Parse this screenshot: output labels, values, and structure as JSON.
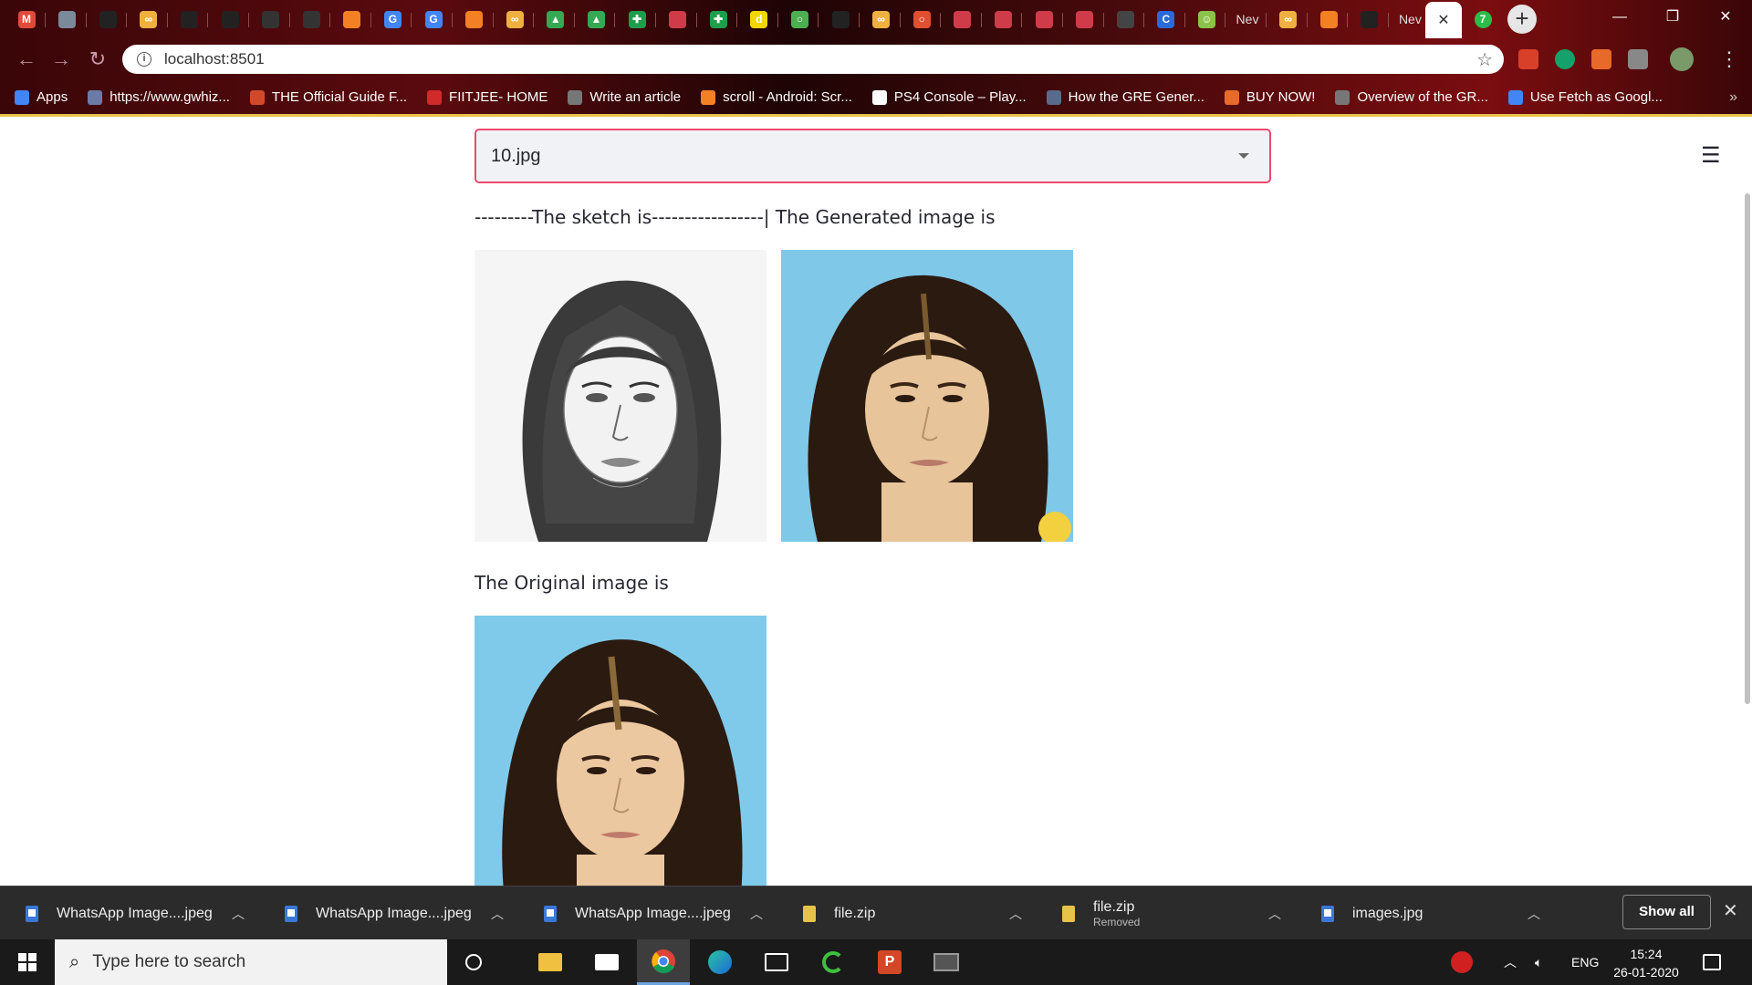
{
  "browser": {
    "tabs": [
      {
        "icon": "gmail-icon",
        "color": "#e04a3a",
        "glyph": "M"
      },
      {
        "icon": "globe-icon",
        "color": "#7a8a9a",
        "glyph": ""
      },
      {
        "icon": "github-icon",
        "color": "#222",
        "glyph": ""
      },
      {
        "icon": "codechef-icon",
        "color": "#f0b040",
        "glyph": "∞"
      },
      {
        "icon": "github-icon",
        "color": "#222",
        "glyph": ""
      },
      {
        "icon": "github-icon",
        "color": "#222",
        "glyph": ""
      },
      {
        "icon": "box-icon",
        "color": "#333",
        "glyph": ""
      },
      {
        "icon": "box-icon",
        "color": "#333",
        "glyph": ""
      },
      {
        "icon": "stackoverflow-icon",
        "color": "#f48024",
        "glyph": ""
      },
      {
        "icon": "google-icon",
        "color": "#4285f4",
        "glyph": "G"
      },
      {
        "icon": "google-icon",
        "color": "#4285f4",
        "glyph": "G"
      },
      {
        "icon": "stackoverflow-icon",
        "color": "#f48024",
        "glyph": ""
      },
      {
        "icon": "codechef-icon",
        "color": "#f0b040",
        "glyph": "∞"
      },
      {
        "icon": "drive-icon",
        "color": "#34a853",
        "glyph": "▲"
      },
      {
        "icon": "drive-icon",
        "color": "#34a853",
        "glyph": "▲"
      },
      {
        "icon": "plus-green-icon",
        "color": "#1e9e4a",
        "glyph": "✚"
      },
      {
        "icon": "mail-red-icon",
        "color": "#d03b4a",
        "glyph": ""
      },
      {
        "icon": "plus-green-icon",
        "color": "#1e9e4a",
        "glyph": "✚"
      },
      {
        "icon": "d-icon",
        "color": "#f2d600",
        "glyph": "d"
      },
      {
        "icon": "circle-green-icon",
        "color": "#4caf50",
        "glyph": "○"
      },
      {
        "icon": "github-icon",
        "color": "#222",
        "glyph": ""
      },
      {
        "icon": "codechef-icon",
        "color": "#f0b040",
        "glyph": "∞"
      },
      {
        "icon": "circle-red-icon",
        "color": "#e05030",
        "glyph": "○"
      },
      {
        "icon": "mail-red-icon",
        "color": "#d03b4a",
        "glyph": ""
      },
      {
        "icon": "mail-red-icon",
        "color": "#d03b4a",
        "glyph": ""
      },
      {
        "icon": "mail-red-icon",
        "color": "#d03b4a",
        "glyph": ""
      },
      {
        "icon": "mail-red-icon",
        "color": "#d03b4a",
        "glyph": ""
      },
      {
        "icon": "pattern-icon",
        "color": "#444",
        "glyph": ""
      },
      {
        "icon": "c-blue-icon",
        "color": "#2a6ad8",
        "glyph": "C"
      },
      {
        "icon": "smiley-icon",
        "color": "#8bc34a",
        "glyph": "☺"
      },
      {
        "icon": "newtab-icon",
        "color": "",
        "glyph": "",
        "text": "Nev"
      },
      {
        "icon": "codechef-icon",
        "color": "#f0b040",
        "glyph": "∞"
      },
      {
        "icon": "stackoverflow-icon",
        "color": "#f48024",
        "glyph": ""
      },
      {
        "icon": "github-icon",
        "color": "#222",
        "glyph": ""
      },
      {
        "icon": "newtab-icon",
        "color": "",
        "glyph": "",
        "text": "Nev"
      }
    ],
    "active_tab_close": "✕",
    "active_tab_glyph": "7",
    "new_tab": "+",
    "window": {
      "minimize": "—",
      "restore": "❐",
      "close": "✕"
    },
    "url": "localhost:8501",
    "bookmarks": [
      {
        "label": "Apps",
        "color": "#4285f4"
      },
      {
        "label": "https://www.gwhiz...",
        "color": "#6a7ba8"
      },
      {
        "label": "THE Official Guide F...",
        "color": "#d04a2a"
      },
      {
        "label": "FIITJEE- HOME",
        "color": "#d02a2a"
      },
      {
        "label": "Write an article",
        "color": "#777"
      },
      {
        "label": "scroll - Android: Scr...",
        "color": "#f48024"
      },
      {
        "label": "PS4 Console – Play...",
        "color": "#fff"
      },
      {
        "label": "How the GRE Gener...",
        "color": "#5a6a8a"
      },
      {
        "label": "BUY NOW!",
        "color": "#e86a2a"
      },
      {
        "label": "Overview of the GR...",
        "color": "#777"
      },
      {
        "label": "Use Fetch as Googl...",
        "color": "#4285f4"
      }
    ],
    "more_bookmarks": "»"
  },
  "app": {
    "select_value": "10.jpg",
    "caption_top": "---------The sketch is-----------------| The Generated image is",
    "caption_original": "The Original image is",
    "menu": "☰"
  },
  "downloads": {
    "items": [
      {
        "name": "WhatsApp Image....jpeg",
        "type": "doc",
        "sub": ""
      },
      {
        "name": "WhatsApp Image....jpeg",
        "type": "doc",
        "sub": ""
      },
      {
        "name": "WhatsApp Image....jpeg",
        "type": "doc",
        "sub": ""
      },
      {
        "name": "file.zip",
        "type": "zip",
        "sub": ""
      },
      {
        "name": "file.zip",
        "type": "zip",
        "sub": "Removed"
      },
      {
        "name": "images.jpg",
        "type": "doc",
        "sub": ""
      }
    ],
    "show_all": "Show all",
    "close": "✕"
  },
  "taskbar": {
    "search_placeholder": "Type here to search",
    "tray_lang": "ENG",
    "time": "15:24",
    "date": "26-01-2020"
  }
}
